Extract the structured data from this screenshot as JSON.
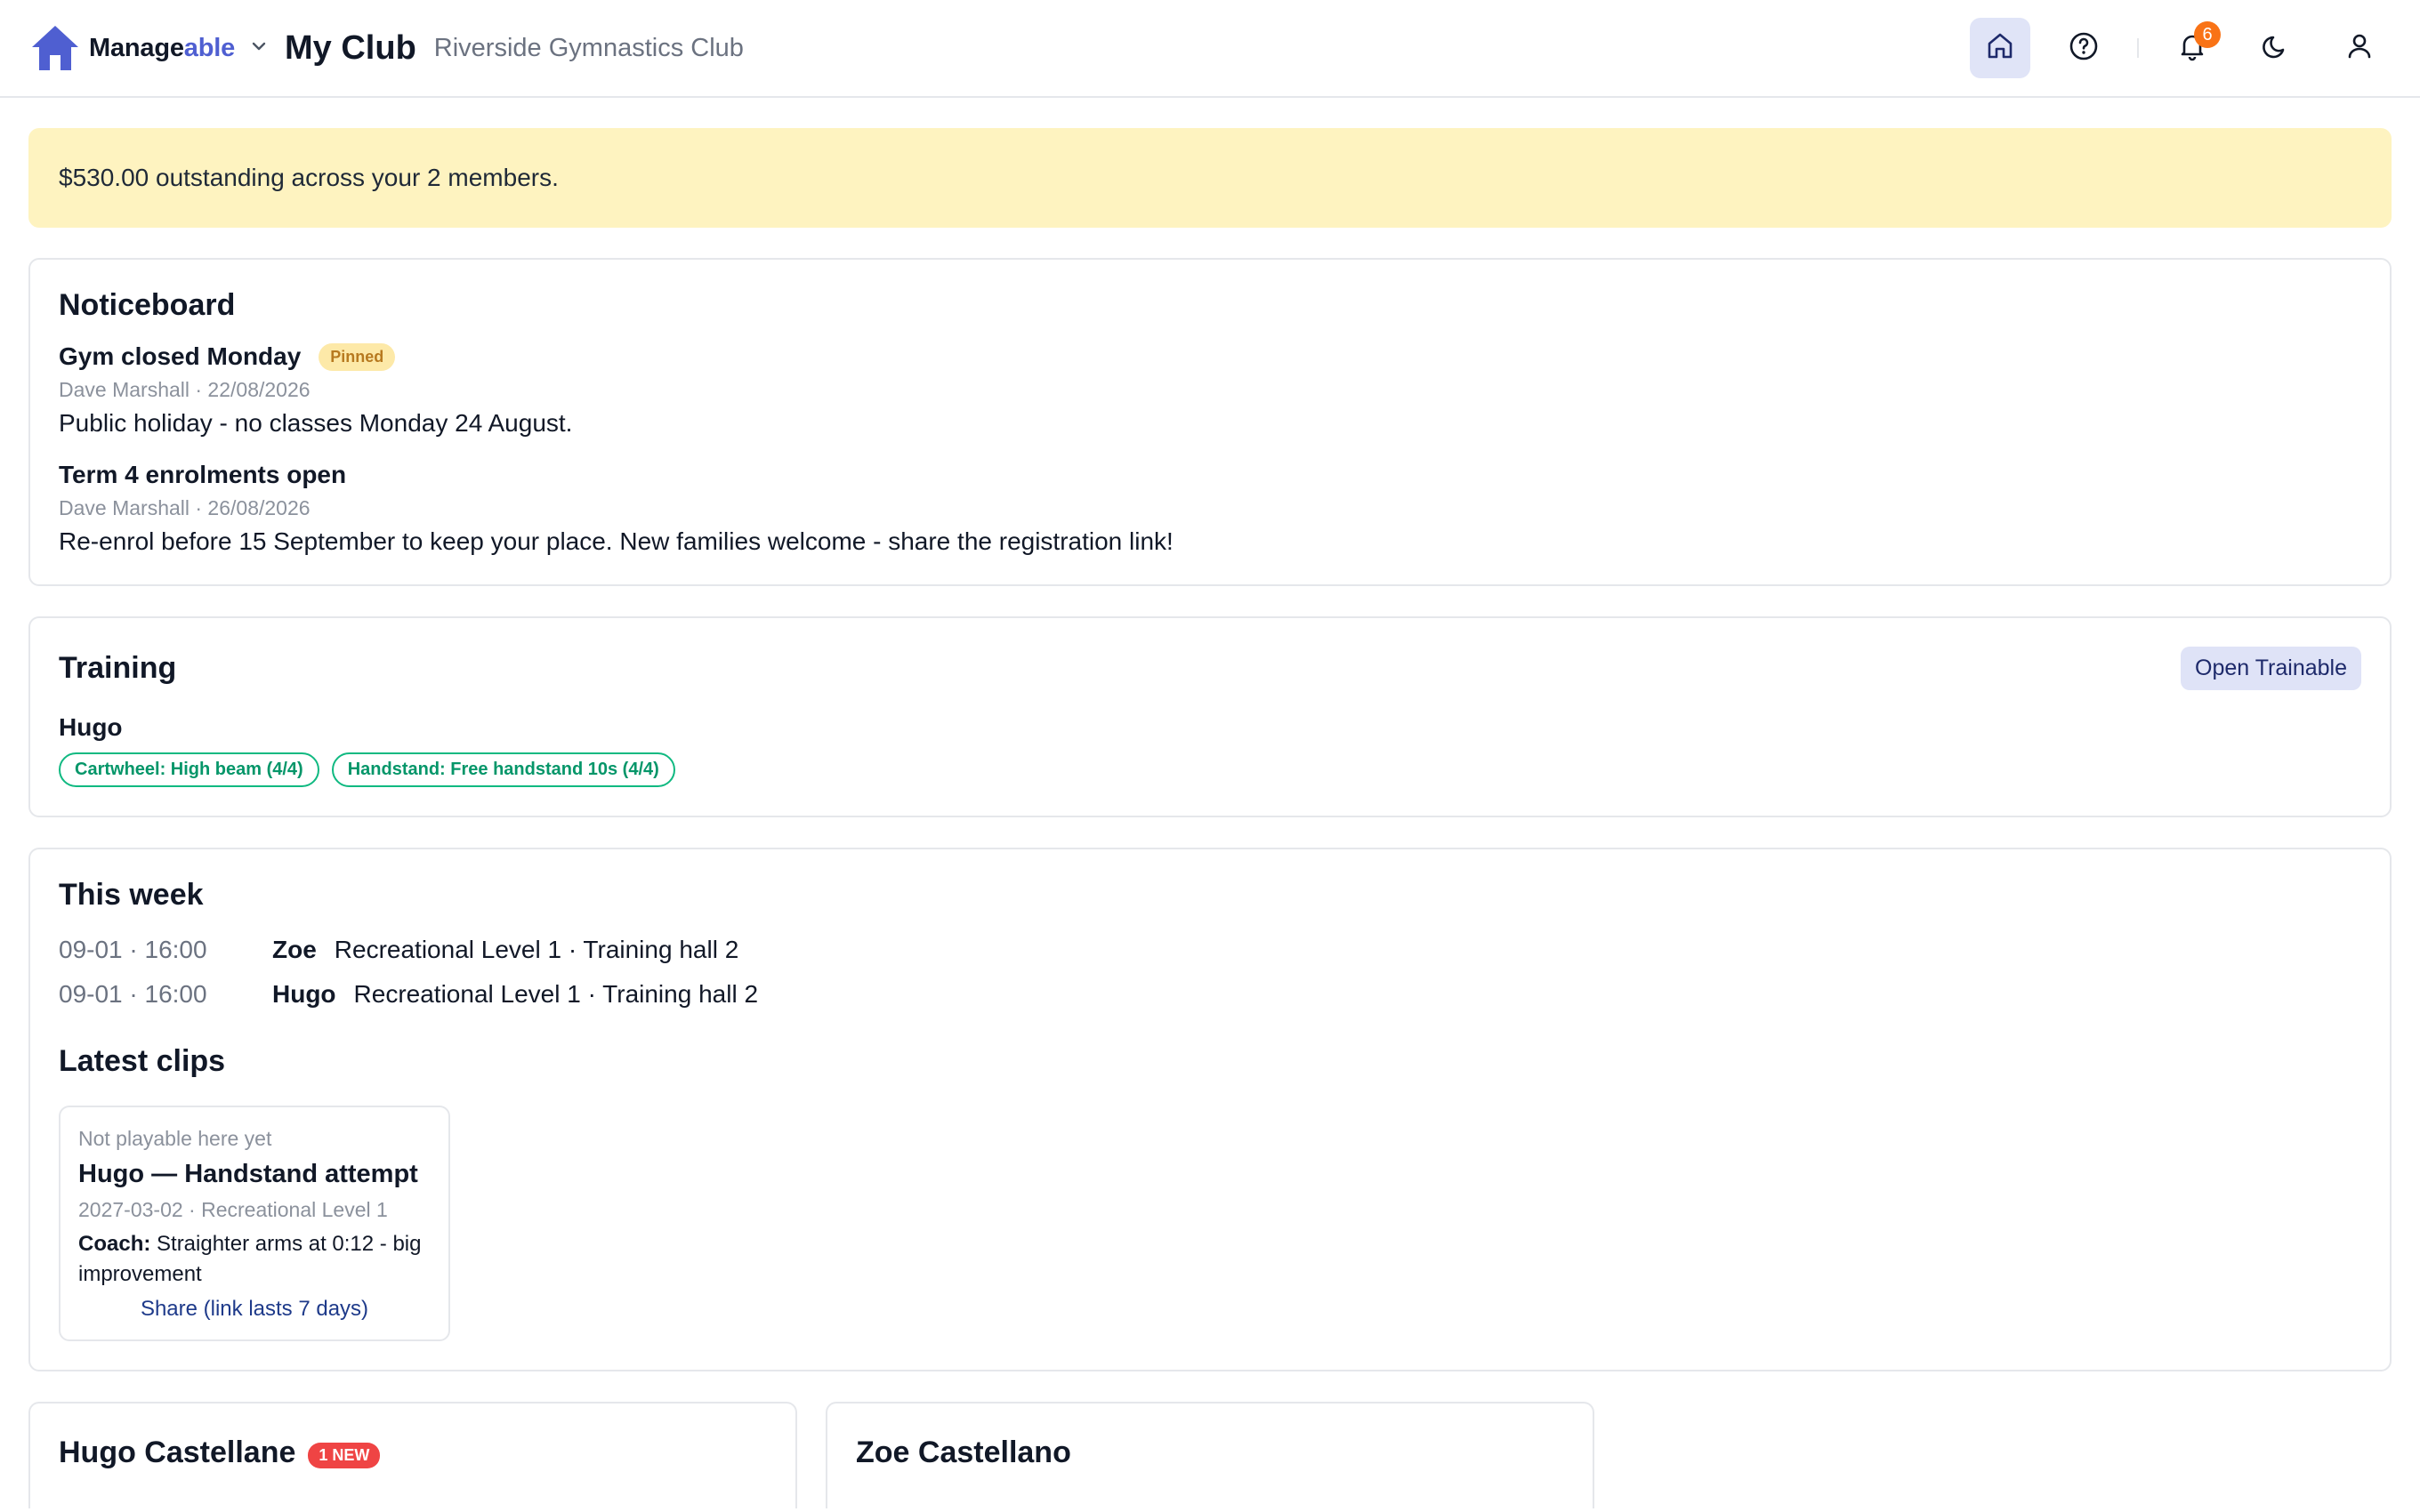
{
  "header": {
    "brand_prefix": "Manage",
    "brand_suffix": "able",
    "page_title": "My Club",
    "club_name": "Riverside Gymnastics Club",
    "notification_count": "6",
    "icons": [
      "home-icon",
      "help-icon",
      "bell-icon",
      "moon-icon",
      "user-icon"
    ]
  },
  "alert": {
    "text": "$530.00 outstanding across your 2 members."
  },
  "noticeboard": {
    "title": "Noticeboard",
    "notices": [
      {
        "title": "Gym closed Monday",
        "badge": "Pinned",
        "meta": "Dave Marshall · 22/08/2026",
        "body": "Public holiday - no classes Monday 24 August."
      },
      {
        "title": "Term 4 enrolments open",
        "meta": "Dave Marshall · 26/08/2026",
        "body": "Re-enrol before 15 September to keep your place. New families welcome - share the registration link!"
      }
    ]
  },
  "training": {
    "title": "Training",
    "open_button": "Open Trainable",
    "trainee": "Hugo",
    "tags": [
      "Cartwheel: High beam (4/4)",
      "Handstand: Free handstand 10s (4/4)"
    ]
  },
  "week": {
    "title": "This week",
    "sessions": [
      {
        "time": "09-01 · 16:00",
        "kid": "Zoe",
        "desc": "Recreational Level 1 · Training hall 2"
      },
      {
        "time": "09-01 · 16:00",
        "kid": "Hugo",
        "desc": "Recreational Level 1 · Training hall 2"
      }
    ]
  },
  "clips": {
    "title": "Latest clips",
    "items": [
      {
        "status": "Not playable here yet",
        "title": "Hugo — Handstand attempt",
        "meta": "2027-03-02 · Recreational Level 1",
        "coach_label": "Coach:",
        "coach_note": " Straighter arms at 0:12 - big improvement",
        "share": "Share (link lasts 7 days)"
      }
    ]
  },
  "members": [
    {
      "name": "Hugo Castellane",
      "badge": "1 NEW"
    },
    {
      "name": "Zoe Castellano"
    }
  ],
  "colors": {
    "accent": "#4f5fd1",
    "alert_bg": "#fef3c0",
    "green": "#10b981",
    "new_badge": "#ef4444",
    "notification": "#f97316"
  }
}
